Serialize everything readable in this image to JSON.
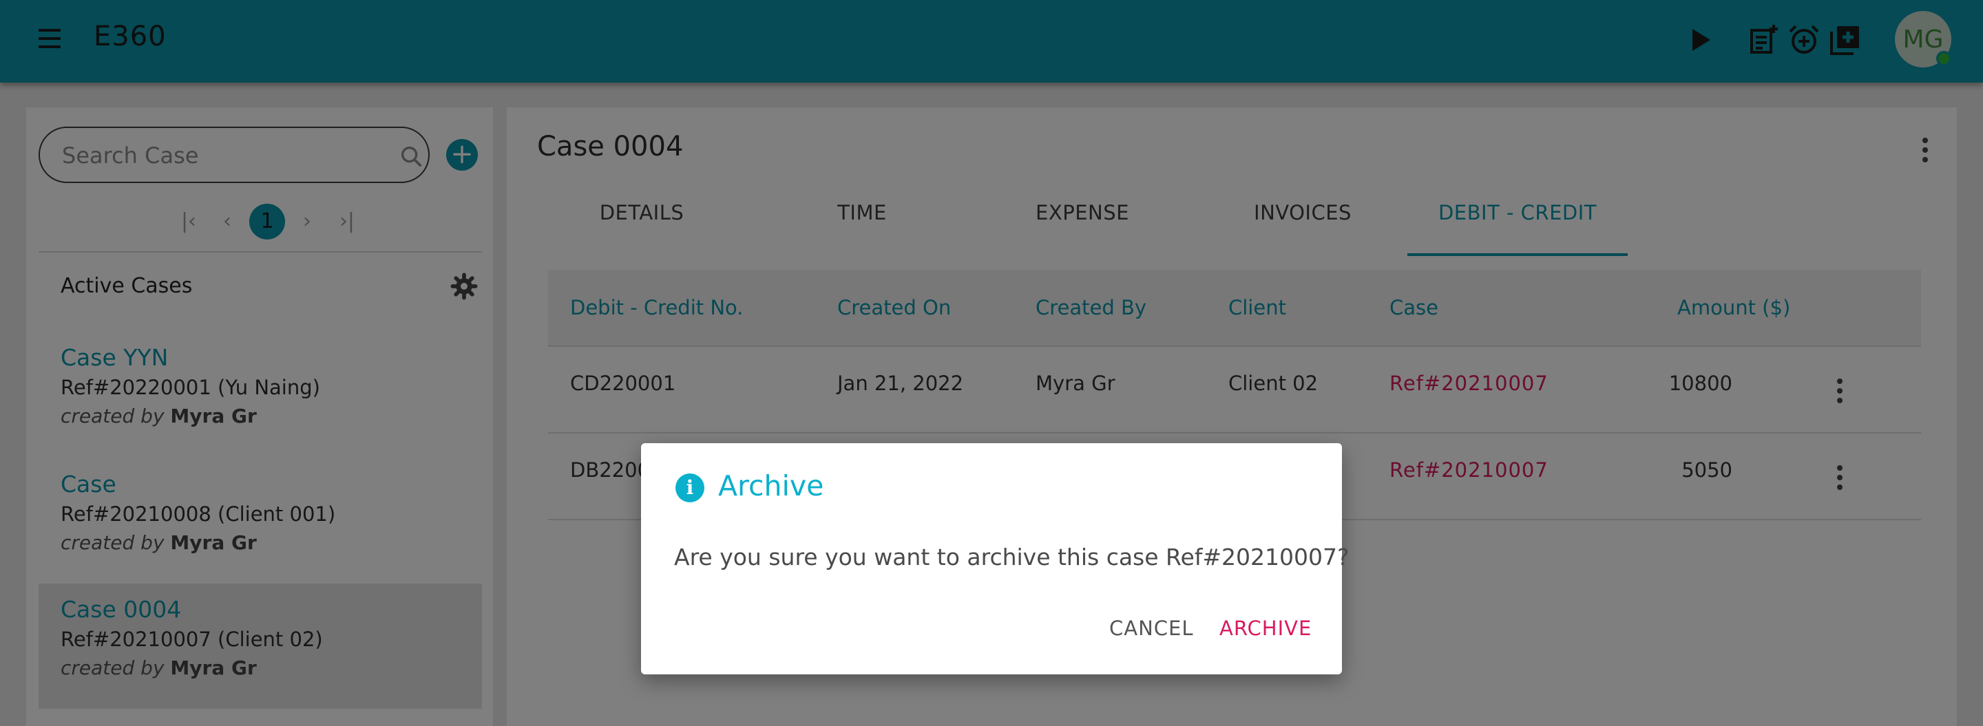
{
  "header": {
    "app_title": "E360",
    "icons": [
      "menu-icon",
      "play-icon",
      "note-add-icon",
      "alarm-add-icon",
      "add-box-icon"
    ],
    "avatar_initials": "MG",
    "accent": "#0a94a8"
  },
  "sidebar": {
    "search_placeholder": "Search Case",
    "pager": {
      "first": "|‹",
      "prev": "‹",
      "current": "1",
      "next": "›",
      "last": "›|"
    },
    "section_title": "Active Cases",
    "cases": [
      {
        "title": "Case YYN",
        "ref": "Ref#20220001 (Yu Naing)",
        "created_prefix": "created by",
        "creator": "Myra Gr"
      },
      {
        "title": "Case",
        "ref": "Ref#20210008 (Client 001)",
        "created_prefix": "created by",
        "creator": "Myra Gr"
      },
      {
        "title": "Case 0004",
        "ref": "Ref#20210007 (Client 02)",
        "created_prefix": "created by",
        "creator": "Myra Gr",
        "selected": true
      }
    ]
  },
  "main": {
    "case_title": "Case 0004",
    "tabs": [
      "DETAILS",
      "TIME",
      "EXPENSE",
      "INVOICES",
      "DEBIT - CREDIT"
    ],
    "active_tab": "DEBIT - CREDIT",
    "table": {
      "columns": [
        "Debit - Credit No.",
        "Created On",
        "Created By",
        "Client",
        "Case",
        "Amount ($)"
      ],
      "rows": [
        {
          "no": "CD220001",
          "created_on": "Jan 21, 2022",
          "created_by": "Myra Gr",
          "client": "Client 02",
          "case": "Ref#20210007",
          "amount": "10800"
        },
        {
          "no": "DB2200",
          "created_on": "",
          "created_by": "",
          "client": "",
          "case": "Ref#20210007",
          "amount": "5050"
        }
      ]
    }
  },
  "dialog": {
    "icon": "info-icon",
    "icon_glyph": "i",
    "title": "Archive",
    "message": "Are you sure you want to archive this case Ref#20210007?",
    "cancel_label": "CANCEL",
    "confirm_label": "ARCHIVE",
    "title_color": "#0ab0cc",
    "confirm_color": "#d81b60"
  }
}
